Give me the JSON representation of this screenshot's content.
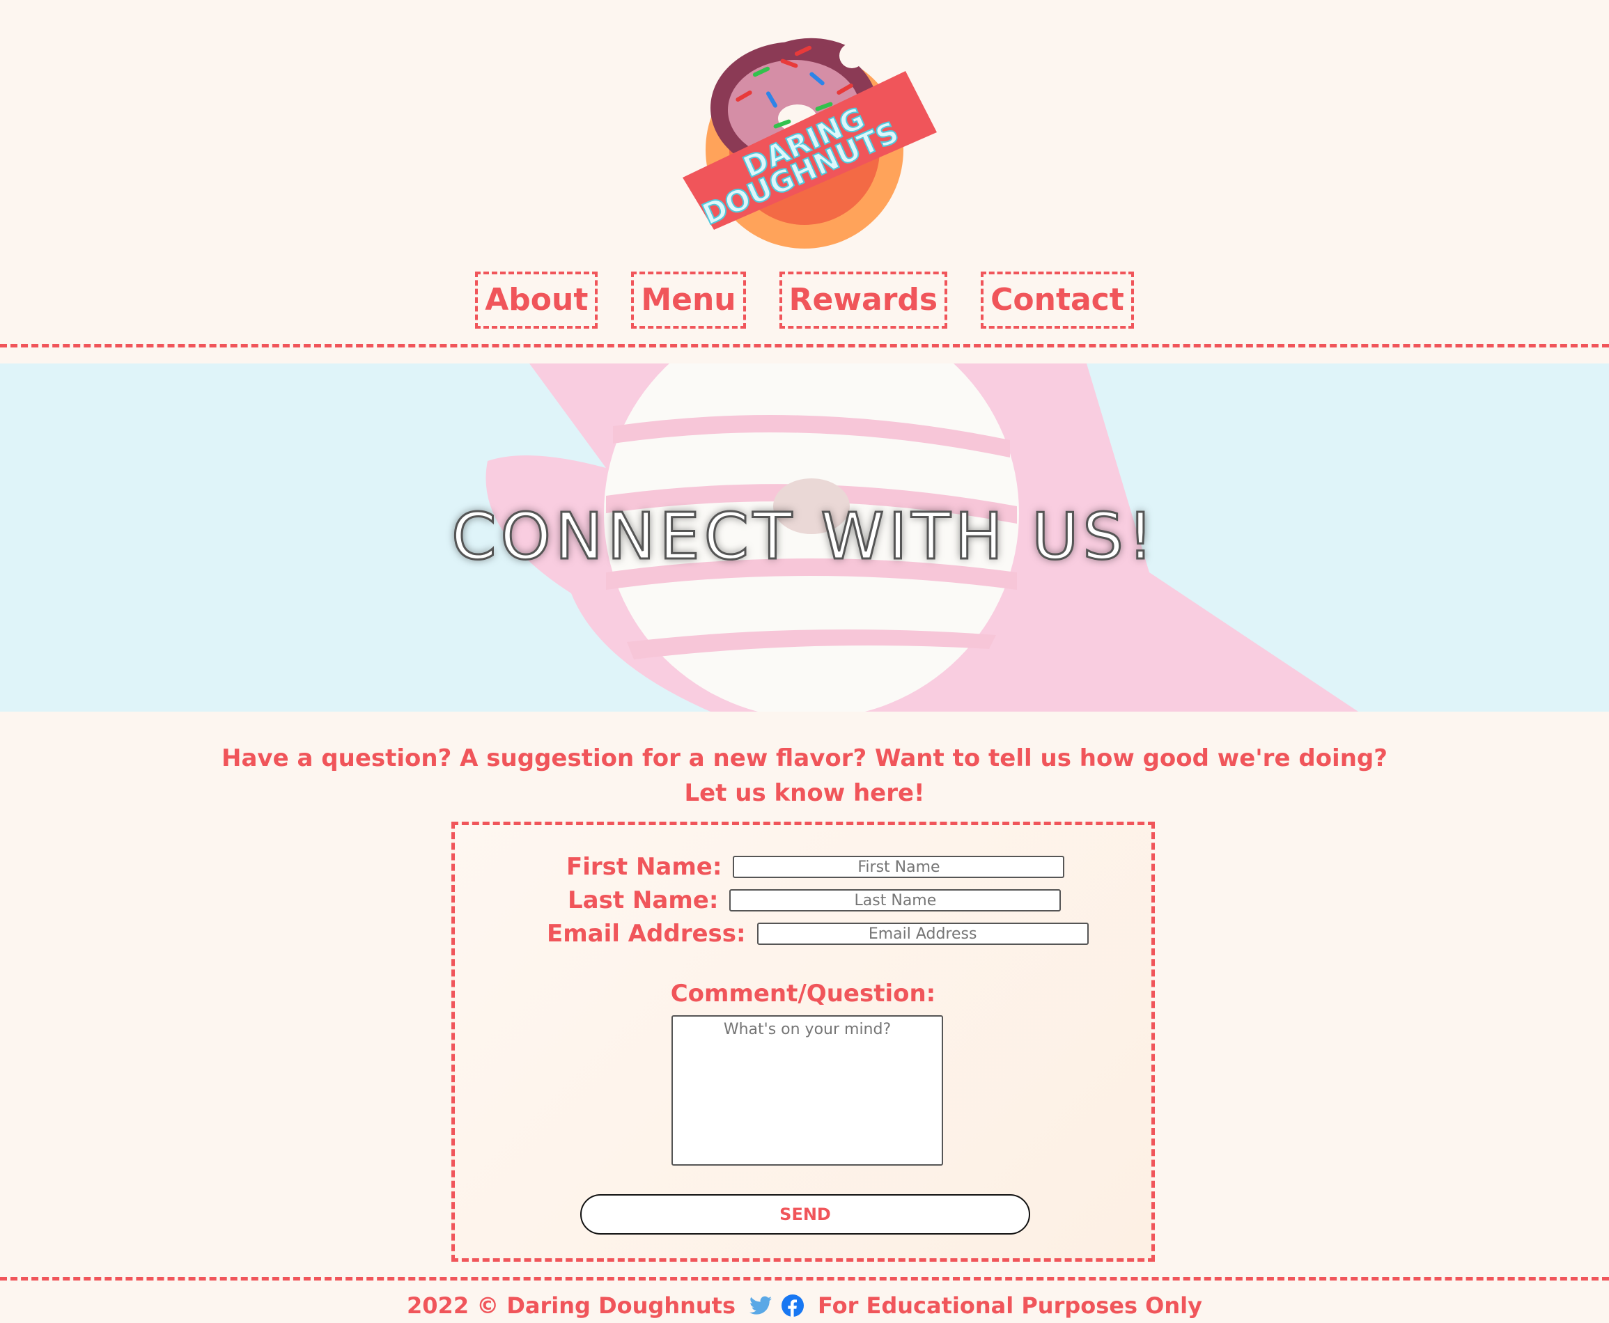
{
  "logo": {
    "line1": "DARING",
    "line2": "DOUGHNUTS"
  },
  "nav": [
    {
      "label": "About"
    },
    {
      "label": "Menu"
    },
    {
      "label": "Rewards"
    },
    {
      "label": "Contact"
    }
  ],
  "hero": {
    "title": "CONNECT WITH US!"
  },
  "intro": {
    "line1": "Have a question? A suggestion for a new flavor? Want to tell us how good we're doing?",
    "line2": "Let us know here!"
  },
  "form": {
    "first_name_label": "First Name:",
    "first_name_placeholder": "First Name",
    "last_name_label": "Last Name:",
    "last_name_placeholder": "Last Name",
    "email_label": "Email Address:",
    "email_placeholder": "Email Address",
    "comment_label": "Comment/Question:",
    "comment_placeholder": "What's on your mind?",
    "send_label": "SEND"
  },
  "footer": {
    "copyright": "2022 © Daring Doughnuts",
    "disclaimer": "For Educational Purposes Only",
    "icons": [
      "twitter-icon",
      "facebook-icon"
    ]
  },
  "colors": {
    "accent": "#f0555a",
    "background": "#fdf6f0",
    "hero_bg": "#dff4f9"
  }
}
